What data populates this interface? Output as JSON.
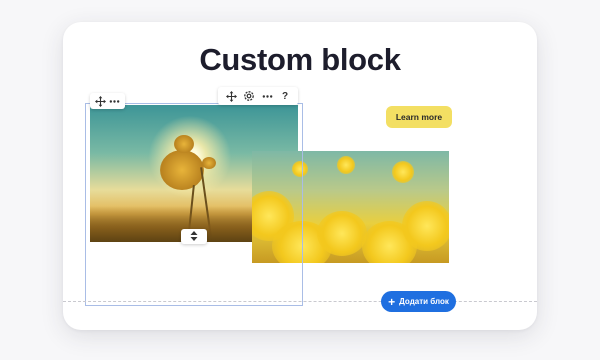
{
  "page": {
    "title": "Custom block",
    "cta_label": "Learn more",
    "add_block_label": "Додати блок",
    "add_block_symbol": "+"
  },
  "toolbar_left": {
    "icons": [
      "move-icon",
      "more-icon"
    ]
  },
  "toolbar_right": {
    "icons": [
      "move-icon",
      "settings-icon",
      "more-icon",
      "help-icon"
    ],
    "help_glyph": "?"
  },
  "colors": {
    "cta_background": "#f3df63",
    "add_block_background": "#1f6fe0",
    "selection_border": "#a9bde6"
  },
  "images": [
    {
      "name": "sunset-flower-photo"
    },
    {
      "name": "yellow-field-photo"
    }
  ]
}
